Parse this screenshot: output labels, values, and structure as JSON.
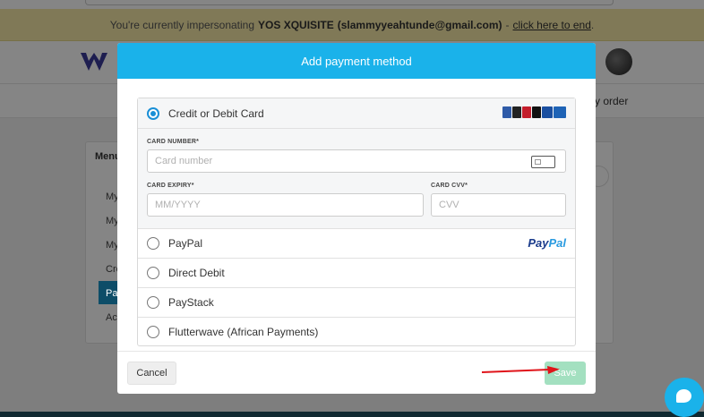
{
  "impersonation": {
    "prefix": "You're currently impersonating",
    "user_name": "YOS XQUISITE",
    "user_email": "(slammyyeahtunde@gmail.com)",
    "separator": "-",
    "end_link": "click here to end",
    "suffix": "."
  },
  "background": {
    "nav_order_fragment": "y order",
    "menu_title": "Menu",
    "menu_fragments": [
      "My",
      "My",
      "My",
      "Cre",
      "Pa",
      "Acc"
    ]
  },
  "modal": {
    "title": "Add payment method",
    "methods": [
      {
        "label": "Credit or Debit Card",
        "selected": true,
        "logo": "card-brands-icons"
      },
      {
        "label": "PayPal",
        "selected": false,
        "logo": "paypal-logo"
      },
      {
        "label": "Direct Debit",
        "selected": false
      },
      {
        "label": "PayStack",
        "selected": false
      },
      {
        "label": "Flutterwave (African Payments)",
        "selected": false
      }
    ],
    "paypal_logo": {
      "part1": "Pay",
      "part2": "Pal"
    },
    "card_form": {
      "number_label": "CARD NUMBER*",
      "number_placeholder": "Card number",
      "expiry_label": "CARD EXPIRY*",
      "expiry_placeholder": "MM/YYYY",
      "cvv_label": "CARD CVV*",
      "cvv_placeholder": "CVV"
    },
    "cancel_label": "Cancel",
    "save_label": "Save"
  },
  "colors": {
    "accent": "#1ab2ea",
    "save_disabled": "#a3e0c0",
    "arrow": "#e0141a",
    "banner": "#f5e9a8"
  }
}
